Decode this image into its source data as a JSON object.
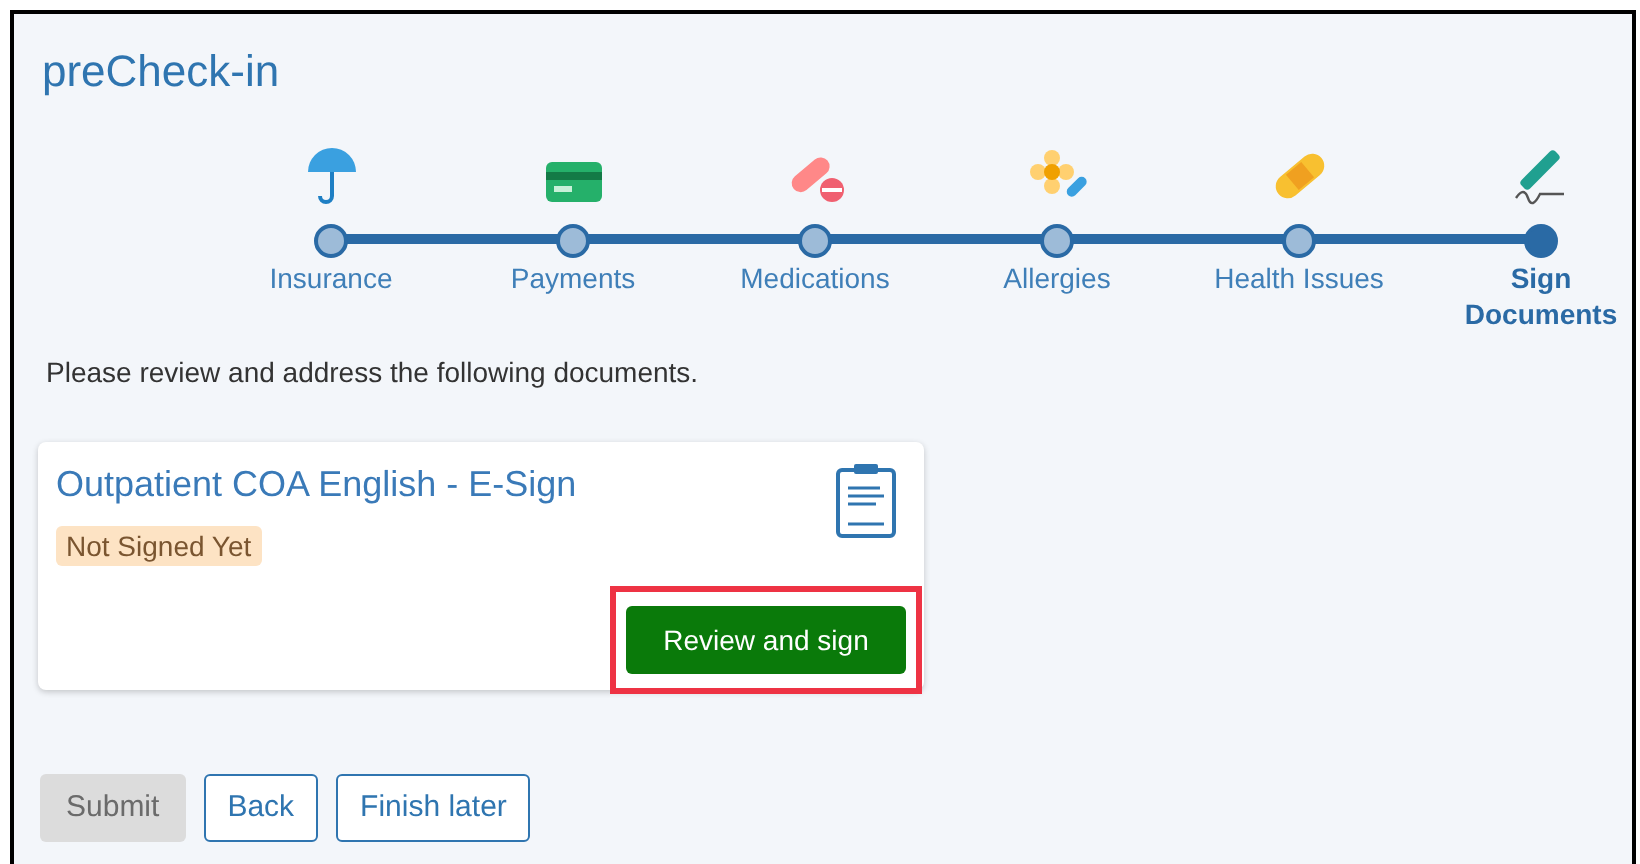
{
  "title": "preCheck-in",
  "steps": [
    {
      "label": "Insurance",
      "selected": false
    },
    {
      "label": "Payments",
      "selected": false
    },
    {
      "label": "Medications",
      "selected": false
    },
    {
      "label": "Allergies",
      "selected": false
    },
    {
      "label": "Health Issues",
      "selected": false
    },
    {
      "label": "Sign Documents",
      "selected": true
    }
  ],
  "instructions": "Please review and address the following documents.",
  "documents": [
    {
      "title": "Outpatient COA English - E-Sign",
      "status": "Not Signed Yet",
      "action": {
        "label": "Review and sign",
        "highlighted": true
      }
    }
  ],
  "buttons": [
    {
      "label": "Submit",
      "disabled": true
    },
    {
      "label": "Back",
      "disabled": false
    },
    {
      "label": "Finish later",
      "disabled": false
    }
  ]
}
